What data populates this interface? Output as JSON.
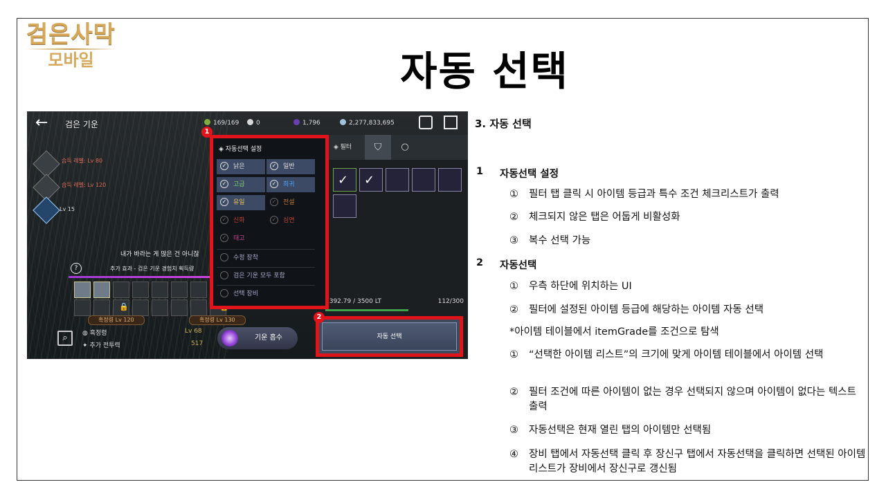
{
  "logo": {
    "line1": "검은사막",
    "line2": "모바일"
  },
  "title": "자동 선택",
  "game": {
    "header_title": "검은 기운",
    "resources": {
      "energy": "169/169",
      "pearl": "0",
      "dark": "1,796",
      "silver": "2,277,833,695"
    },
    "skills": [
      {
        "label": "습득 레벨: Lv 80"
      },
      {
        "label": "습득 레벨: Lv 120"
      },
      {
        "label": "Lv 15"
      }
    ],
    "quote": "내가 바라는 게 많은 건 아니잖",
    "effect": "추가 효과 - 검은 기운 경험치 획득량",
    "lv_tags": [
      "흑정령 Lv 120",
      "흑정령 Lv 130"
    ],
    "stats": [
      {
        "label": "흑정령",
        "value": "Lv 68"
      },
      {
        "label": "추가 전투력",
        "value": "517"
      }
    ],
    "absorb_button": "기운 흡수",
    "popup": {
      "header": "자동선택 설정",
      "grades": [
        {
          "label": "낡은",
          "on": true,
          "color": "#dddddd"
        },
        {
          "label": "일반",
          "on": true,
          "color": "#dddddd"
        },
        {
          "label": "고급",
          "on": true,
          "color": "#7ccf6a"
        },
        {
          "label": "희귀",
          "on": true,
          "color": "#4aa3ff"
        },
        {
          "label": "유일",
          "on": true,
          "color": "#e7c24a"
        },
        {
          "label": "전설",
          "on": false,
          "color": "#e38a2e"
        },
        {
          "label": "신화",
          "on": false,
          "color": "#e2473a"
        },
        {
          "label": "심연",
          "on": false,
          "color": "#e2473a"
        },
        {
          "label": "태고",
          "on": false,
          "color": "#e64aa9"
        }
      ],
      "options": [
        "수정 장착",
        "검은 기운 모두 포함",
        "선택 장비"
      ]
    },
    "inventory": {
      "filter_tab": "필터",
      "capacity": "1392.79 / 3500 LT",
      "count": "112/300",
      "auto_select_button": "자동 선택"
    },
    "badges": [
      "1",
      "2"
    ]
  },
  "notes": {
    "heading": "3. 자동 선택",
    "sections": [
      {
        "num": "1",
        "title": "자동선택 설정"
      },
      {
        "num": "2",
        "title": "자동선택"
      }
    ],
    "items": [
      {
        "bullet": "①",
        "text": "필터 탭 클릭 시 아이템 등급과 특수 조건 체크리스트가 출력"
      },
      {
        "bullet": "②",
        "text": "체크되지 않은 탭은 어둡게 비활성화"
      },
      {
        "bullet": "③",
        "text": "복수 선택 가능"
      },
      {
        "bullet": "①",
        "text": "우측 하단에 위치하는 UI"
      },
      {
        "bullet": "②",
        "text": "필터에 설정된 아이템 등급에 해당하는 아이템 자동 선택"
      },
      {
        "bullet": "",
        "text": "*아이템 테이블에서 itemGrade를 조건으로 탐색"
      },
      {
        "bullet": "①",
        "text": "“선택한 아이템 리스트”의 크기에 맞게 아이템 테이블에서 아이템 선택"
      },
      {
        "bullet": "②",
        "text": "필터 조건에 따른 아이템이 없는 경우 선택되지 않으며 아이템이 없다는 텍스트 출력"
      },
      {
        "bullet": "③",
        "text": "자동선택은 현재 열린 탭의 아이템만 선택됨"
      },
      {
        "bullet": "④",
        "text": "장비 탭에서 자동선택 클릭 후 장신구 탭에서 자동선택을 클릭하면 선택된 아이템 리스트가 장비에서 장신구로 갱신됨"
      }
    ]
  }
}
